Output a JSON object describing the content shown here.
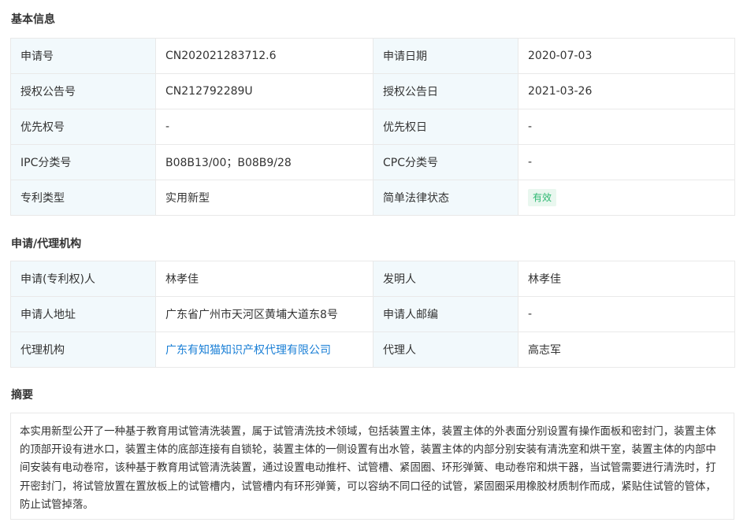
{
  "basic": {
    "title": "基本信息",
    "rows": [
      {
        "l1": "申请号",
        "v1": "CN202021283712.6",
        "l2": "申请日期",
        "v2": "2020-07-03"
      },
      {
        "l1": "授权公告号",
        "v1": "CN212792289U",
        "l2": "授权公告日",
        "v2": "2021-03-26"
      },
      {
        "l1": "优先权号",
        "v1": "-",
        "l2": "优先权日",
        "v2": "-"
      },
      {
        "l1": "IPC分类号",
        "v1": "B08B13/00；B08B9/28",
        "l2": "CPC分类号",
        "v2": "-"
      },
      {
        "l1": "专利类型",
        "v1": "实用新型",
        "l2": "简单法律状态",
        "v2": "有效"
      }
    ]
  },
  "agency": {
    "title": "申请/代理机构",
    "rows": [
      {
        "l1": "申请(专利权)人",
        "v1": "林孝佳",
        "l2": "发明人",
        "v2": "林孝佳"
      },
      {
        "l1": "申请人地址",
        "v1": "广东省广州市天河区黄埔大道东8号",
        "l2": "申请人邮编",
        "v2": "-"
      },
      {
        "l1": "代理机构",
        "v1": "广东有知猫知识产权代理有限公司",
        "l2": "代理人",
        "v2": "高志军"
      }
    ]
  },
  "abstract": {
    "title": "摘要",
    "text": "本实用新型公开了一种基于教育用试管清洗装置，属于试管清洗技术领域，包括装置主体，装置主体的外表面分别设置有操作面板和密封门，装置主体的顶部开设有进水口，装置主体的底部连接有自锁轮，装置主体的一侧设置有出水管，装置主体的内部分别安装有清洗室和烘干室，装置主体的内部中间安装有电动卷帘，该种基于教育用试管清洗装置，通过设置电动推杆、试管槽、紧固圈、环形弹簧、电动卷帘和烘干器，当试管需要进行清洗时，打开密封门，将试管放置在置放板上的试管槽内，试管槽内有环形弹簧，可以容纳不同口径的试管，紧固圈采用橡胶材质制作而成，紧贴住试管的管体，防止试管掉落。"
  },
  "colors": {
    "label_bg": "#f2f9fc",
    "border": "#e9e9e9",
    "link": "#1a7fd6",
    "status_green": "#2eb872",
    "status_bg": "#e9f7ef"
  }
}
